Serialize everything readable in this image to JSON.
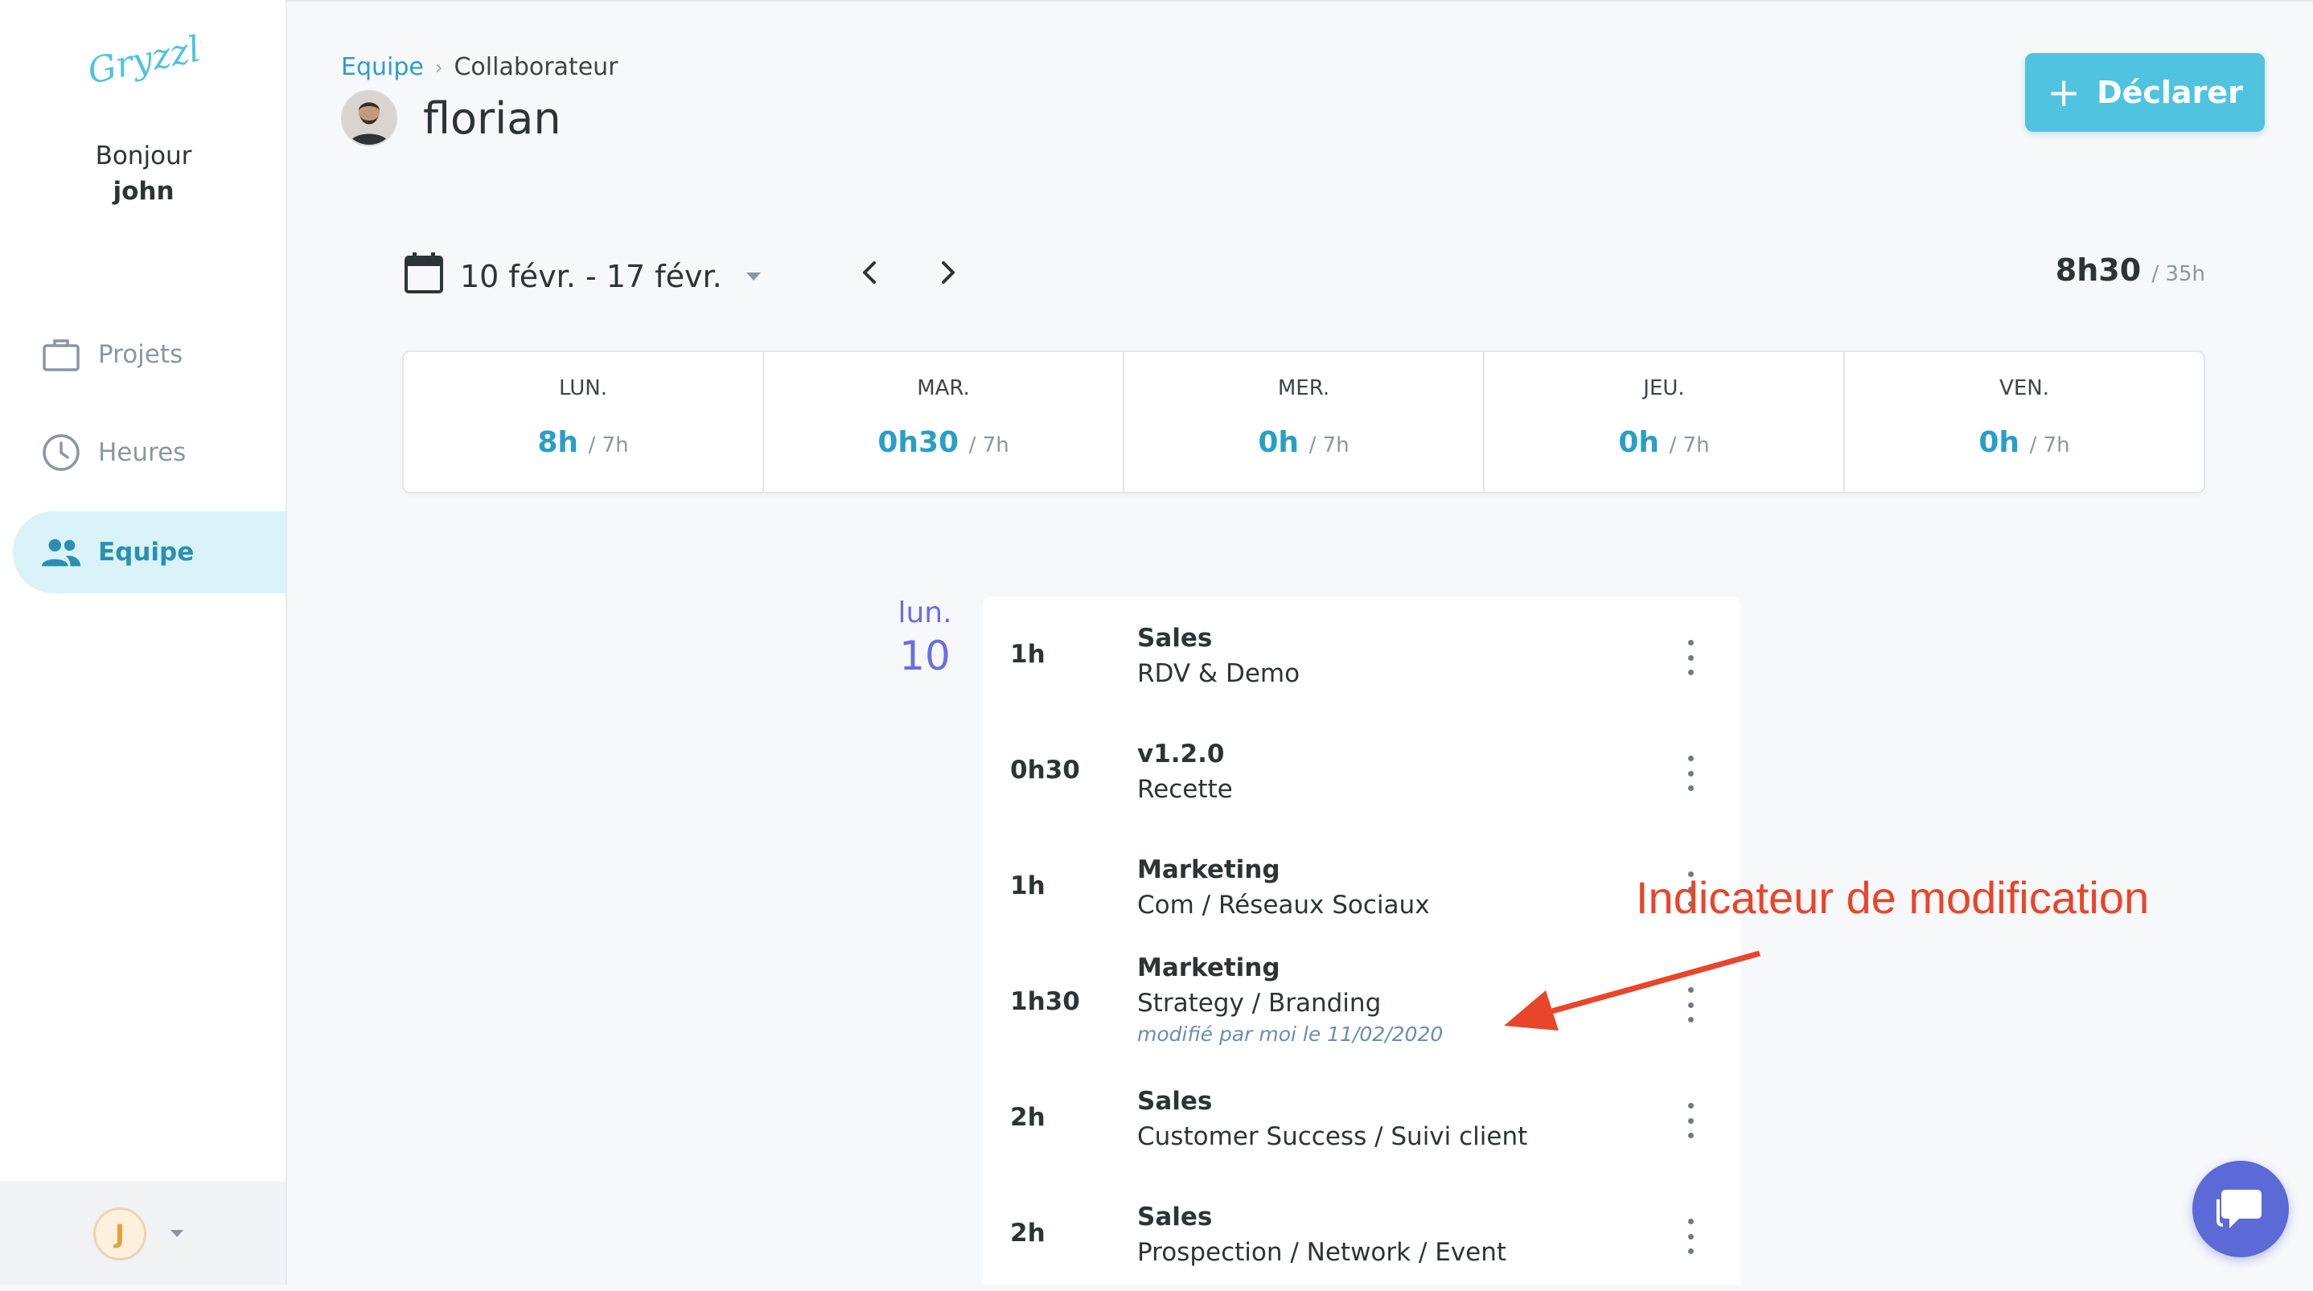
{
  "app": {
    "logo_text": "Gryzzly"
  },
  "sidebar": {
    "greeting": "Bonjour",
    "username": "john",
    "items": [
      {
        "label": "Projets",
        "icon": "briefcase-icon",
        "active": false
      },
      {
        "label": "Heures",
        "icon": "clock-icon",
        "active": false
      },
      {
        "label": "Equipe",
        "icon": "people-icon",
        "active": true
      }
    ],
    "user_initial": "J"
  },
  "header": {
    "breadcrumb_parent": "Equipe",
    "breadcrumb_separator": "›",
    "breadcrumb_current": "Collaborateur",
    "person_name": "florian",
    "declare_label": "Déclarer",
    "declare_icon": "+"
  },
  "period": {
    "range": "10 févr. - 17 févr.",
    "total": "8h30",
    "total_max": "/ 35h"
  },
  "days": [
    {
      "label": "LUN.",
      "value": "8h",
      "max": "/ 7h"
    },
    {
      "label": "MAR.",
      "value": "0h30",
      "max": "/ 7h"
    },
    {
      "label": "MER.",
      "value": "0h",
      "max": "/ 7h"
    },
    {
      "label": "JEU.",
      "value": "0h",
      "max": "/ 7h"
    },
    {
      "label": "VEN.",
      "value": "0h",
      "max": "/ 7h"
    }
  ],
  "selected_day": {
    "dow": "lun.",
    "num": "10"
  },
  "entries": [
    {
      "duration": "1h",
      "project": "Sales",
      "task": "RDV & Demo",
      "modified": ""
    },
    {
      "duration": "0h30",
      "project": "v1.2.0",
      "task": "Recette",
      "modified": ""
    },
    {
      "duration": "1h",
      "project": "Marketing",
      "task": "Com / Réseaux Sociaux",
      "modified": ""
    },
    {
      "duration": "1h30",
      "project": "Marketing",
      "task": "Strategy / Branding",
      "modified": "modifié par moi le 11/02/2020"
    },
    {
      "duration": "2h",
      "project": "Sales",
      "task": "Customer Success / Suivi client",
      "modified": ""
    },
    {
      "duration": "2h",
      "project": "Sales",
      "task": "Prospection / Network / Event",
      "modified": ""
    }
  ],
  "annotation": {
    "text": "Indicateur de modification",
    "color": "#e8452a"
  },
  "colors": {
    "accent": "#4fc3e0",
    "link": "#2a9fc5",
    "day_accent": "#6a6ee0",
    "chat": "#5b6ad6"
  }
}
